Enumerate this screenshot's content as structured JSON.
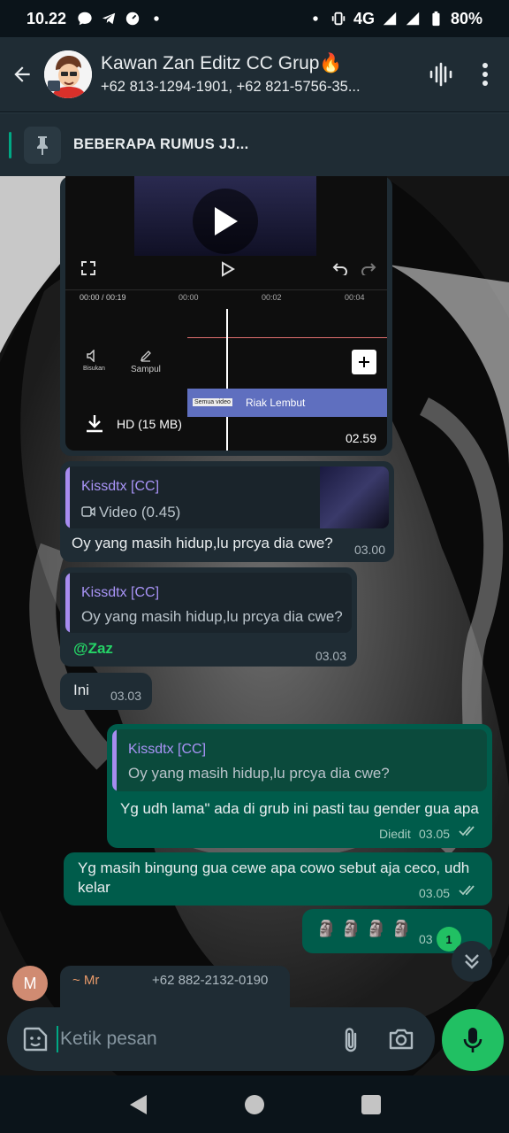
{
  "status": {
    "time": "10.22",
    "network": "4G",
    "battery": "80%"
  },
  "header": {
    "title": "Kawan Zan Editz CC Grup🔥",
    "subtitle": "+62 813-1294-1901, +62 821-5756-35..."
  },
  "pinned": {
    "text": "BEBERAPA RUMUS JJ..."
  },
  "video_message": {
    "timeline": [
      "00:00 / 00:19",
      "00:00",
      "00:02",
      "00:04"
    ],
    "tool_mute": "Bisukan",
    "tool_cover": "Sampul",
    "audio_tag": "Semua video",
    "audio_label": "Riak Lembut",
    "download_label": "HD (15 MB)",
    "time": "02.59"
  },
  "messages": [
    {
      "reply_name": "Kissdtx [CC]",
      "reply_text": "Video (0.45)",
      "text": "Oy yang masih hidup,lu prcya dia cwe?",
      "time": "03.00"
    },
    {
      "reply_name": "Kissdtx [CC]",
      "reply_text": "Oy yang masih hidup,lu prcya dia cwe?",
      "text": "@Zaz",
      "time": "03.03"
    },
    {
      "text": "Ini",
      "time": "03.03"
    },
    {
      "reply_name": "Kissdtx [CC]",
      "reply_text": "Oy yang masih hidup,lu prcya dia cwe?",
      "text": "Yg udh lama\" ada di grub ini pasti tau gender gua apa",
      "edited": "Diedit",
      "time": "03.05"
    },
    {
      "text_line1": "Yg masih bingung gua cewe apa cowo sebut aja ceco, udh",
      "text_line2": "kelar",
      "time": "03.05"
    },
    {
      "text": "🗿🗿🗿🗿",
      "time": "03"
    },
    {
      "sender": "~ Mr",
      "sender_phone": "+62 882-2132-0190",
      "avatar_letter": "M"
    }
  ],
  "unread_count": "1",
  "input": {
    "placeholder": "Ketik pesan"
  },
  "colors": {
    "accent": "#00a884",
    "out_bubble": "#005c4b",
    "in_bubble": "#1f2c34",
    "mic": "#21c063"
  }
}
